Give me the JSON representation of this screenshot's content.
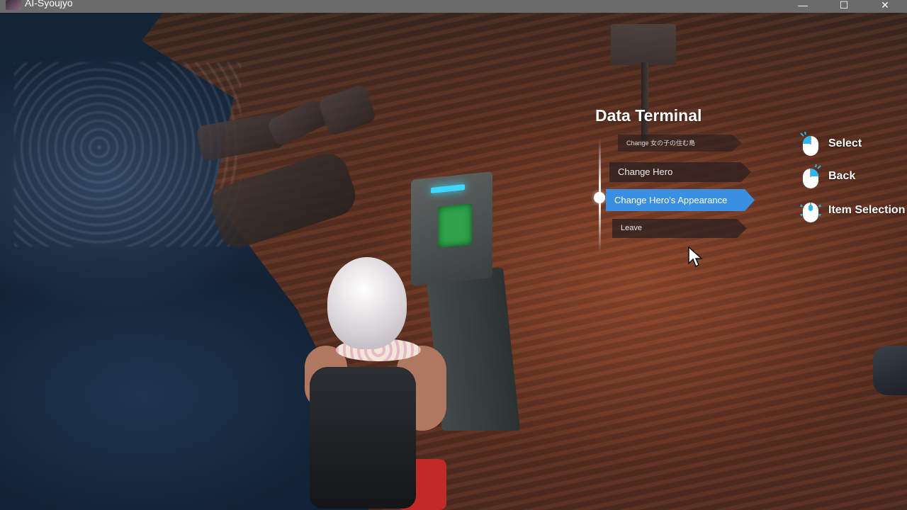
{
  "window": {
    "title": "AI-Syoujyo",
    "minimize": "—",
    "maximize": "☐",
    "close": "✕"
  },
  "menu": {
    "title": "Data Terminal",
    "items": [
      {
        "label": "Change 女の子の住む島",
        "selected": false
      },
      {
        "label": "Change Hero",
        "selected": false
      },
      {
        "label": "Change Hero's Appearance",
        "selected": true
      },
      {
        "label": "Leave",
        "selected": false
      }
    ]
  },
  "controls": [
    {
      "icon": "mouse-left-click-icon",
      "label": "Select"
    },
    {
      "icon": "mouse-right-click-icon",
      "label": "Back"
    },
    {
      "icon": "mouse-scroll-icon",
      "label": "Item Selection"
    }
  ],
  "colors": {
    "selected_item": "#3a8fe2",
    "mouse_accent": "#2bb6f0"
  }
}
